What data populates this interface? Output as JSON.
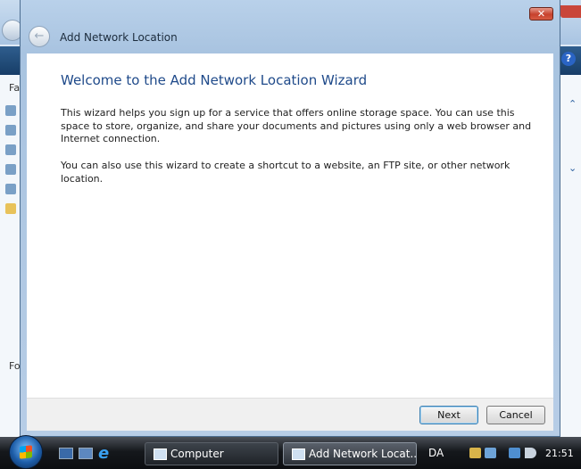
{
  "background_window": {
    "left_letters": [
      "Fa",
      "Fo"
    ],
    "help_label": "?"
  },
  "dialog": {
    "title": "Add Network Location",
    "close_label": "✕",
    "back_label": "←",
    "heading": "Welcome to the Add Network Location Wizard",
    "paragraph1": "This wizard helps you sign up for a service that offers online storage space.  You can use this space to store, organize, and share your documents and pictures using only a web browser and Internet connection.",
    "paragraph2": "You can also use this wizard to create a shortcut to a website, an FTP site, or other network location.",
    "next_label": "Next",
    "cancel_label": "Cancel"
  },
  "taskbar": {
    "ie_glyph": "e",
    "tasks": [
      {
        "label": "Computer"
      },
      {
        "label": "Add Network Locat..."
      }
    ],
    "language": "DA",
    "clock": "21:51"
  }
}
